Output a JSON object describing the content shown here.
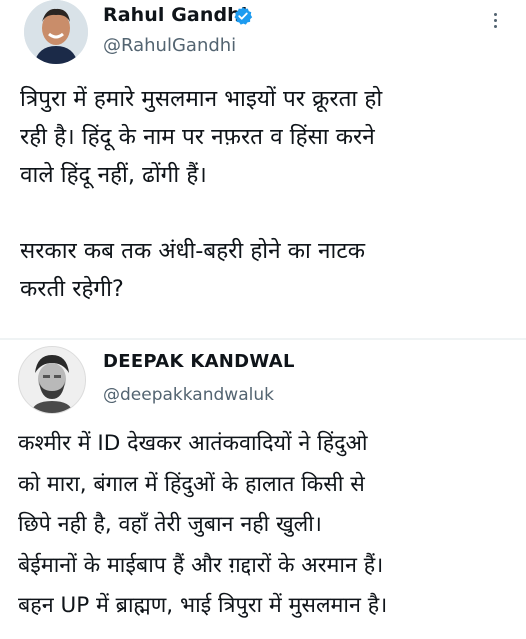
{
  "tweets": [
    {
      "author_name": "Rahul Gandhi",
      "author_handle": "@RahulGandhi",
      "verified": true,
      "text": "त्रिपुरा में हमारे मुसलमान भाइयों पर क्रूरता हो\nरही है। हिंदू के नाम पर नफ़रत व हिंसा करने\nवाले हिंदू नहीं, ढोंगी हैं।\n\nसरकार कब तक अंधी-बहरी होने का नाटक\nकरती रहेगी?"
    },
    {
      "author_name": "DEEPAK KANDWAL",
      "author_handle": "@deepakkandwaluk",
      "verified": false,
      "text": "कश्मीर में ID देखकर आतंकवादियों ने हिंदुओ\nको मारा, बंगाल में हिंदुओं के हालात किसी से\nछिपे नही है, वहाँ तेरी जुबान नही खुली।\nबेईमानों के माईबाप हैं और ग़द्दारों के अरमान हैं।\nबहन UP में ब्राह्मण, भाई त्रिपुरा में मुसलमान है।"
    }
  ],
  "icons": {
    "verified_badge": "verified-badge-icon",
    "more_menu": "more-options-icon"
  },
  "colors": {
    "verified_blue": "#1d9bf0",
    "secondary_text": "#536471",
    "divider": "#eff3f4"
  }
}
